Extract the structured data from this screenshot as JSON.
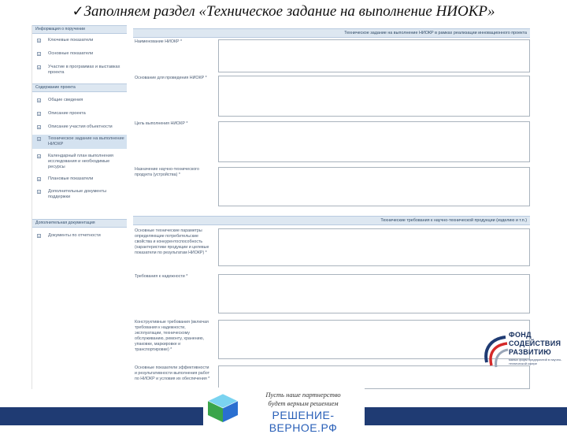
{
  "slide": {
    "check_glyph": "✓",
    "title": "Заполняем раздел «Техническое задание на выполнение НИОКР»"
  },
  "sidebar": {
    "panels": [
      {
        "header": "Информация о поручении",
        "items": [
          {
            "label": "Ключевые показатели",
            "active": false
          },
          {
            "label": "Основные показатели",
            "active": false
          },
          {
            "label": "Участие в программах и выставках проекта",
            "active": false
          }
        ]
      },
      {
        "header": "Содержание проекта",
        "items": [
          {
            "label": "Общие сведения",
            "active": false
          },
          {
            "label": "Описание проекта",
            "active": false
          },
          {
            "label": "Описание участия объектности",
            "active": false
          },
          {
            "label": "Техническое задание на выполнение НИОКР",
            "active": true
          },
          {
            "label": "Календарный план выполнения исследования и необходимые ресурсы",
            "active": false
          },
          {
            "label": "Плановые показатели",
            "active": false
          },
          {
            "label": "Дополнительные документы поддержки",
            "active": false
          }
        ]
      },
      {
        "header": "Дополнительная документация",
        "items": [
          {
            "label": "Документы по отчетности",
            "active": false
          }
        ]
      }
    ]
  },
  "form": {
    "section1_header": "Техническое задание на выполнение НИОКР в рамках реализации инновационного проекта",
    "section1_fields": [
      {
        "label": "Наименование НИОКР *"
      },
      {
        "label": "Основание для проведения НИОКР *"
      },
      {
        "label": "Цель выполнения НИОКР *"
      },
      {
        "label": "Назначение научно-технического продукта (устройства) *"
      }
    ],
    "section2_header": "Технические требования к научно-технической продукции (изделию и т.п.)",
    "section2_fields": [
      {
        "label": "Основные технические параметры определяющие потребительские свойства и конкурентоспособность (характеристики продукции и целевые показатели по результатам НИОКР) *"
      },
      {
        "label": "Требования к надежности *"
      },
      {
        "label": "Конструктивные требования (включая требования к надежности, эксплуатации, техническому обслуживанию, ремонту, хранению, упаковке, маркировке и транспортировке) *"
      },
      {
        "label": "Основные показатели эффективности и результативности выполнения работ по НИОКР и условия их обеспечения *"
      }
    ]
  },
  "fund_logo": {
    "line1": "ФОНД",
    "line2": "СОДЕЙСТВИЯ",
    "line3": "РАЗВИТИЮ",
    "subtitle": "малых форм предприятий в научно-технической сфере"
  },
  "banner": {
    "slogan_line1": "Пусть наше партнерство",
    "slogan_line2": "будет верным решением",
    "domain": "РЕШЕНИЕ-ВЕРНОЕ.РФ"
  }
}
